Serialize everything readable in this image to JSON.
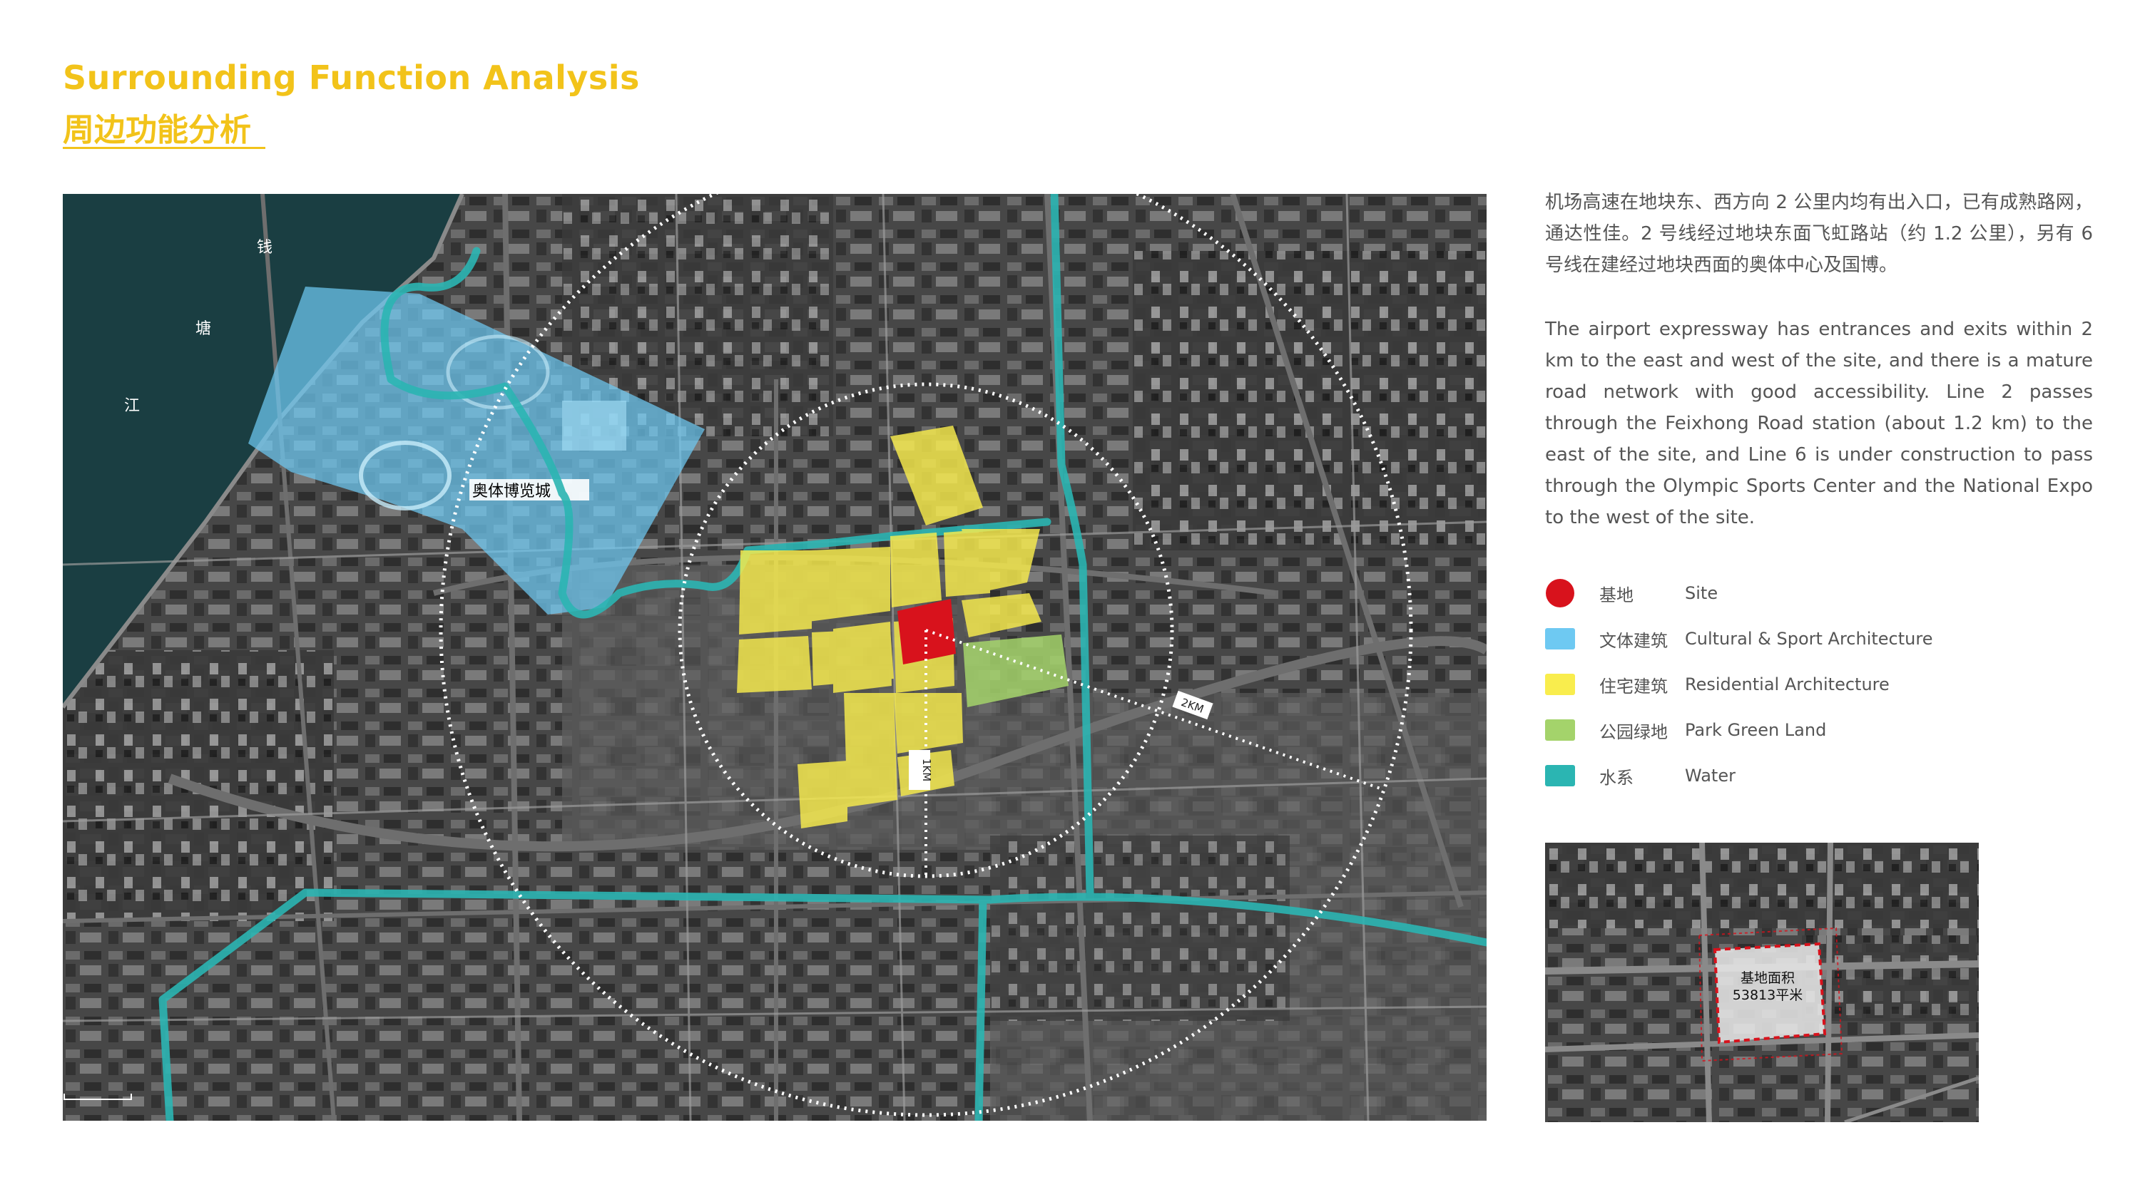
{
  "header": {
    "title_en": "Surrounding Function Analysis",
    "title_cn": "周边功能分析"
  },
  "map": {
    "river_chars": [
      "钱",
      "塘",
      "江"
    ],
    "expo_label": "奥体博览城",
    "radius_1km": "1KM",
    "radius_2km": "2KM"
  },
  "description": {
    "cn": "机场高速在地块东、西方向 2 公里内均有出入口，已有成熟路网，通达性佳。2 号线经过地块东面飞虹路站（约 1.2 公里），另有 6 号线在建经过地块西面的奥体中心及国博。",
    "en": "The airport expressway has entrances and exits within 2 km to the east and west of the site, and there is a mature road network with good accessibility. Line 2 passes through the Feixhong Road station (about 1.2 km) to the east of the site, and Line 6 is under construction to pass through the Olympic Sports Center and the National Expo to the west of the site."
  },
  "legend": [
    {
      "cn": "基地",
      "en": "Site",
      "color": "#d8121c",
      "shape": "circle"
    },
    {
      "cn": "文体建筑",
      "en": "Cultural & Sport Architecture",
      "color": "#6ec9f2",
      "shape": "rect"
    },
    {
      "cn": "住宅建筑",
      "en": "Residential Architecture",
      "color": "#f9ed4d",
      "shape": "rect"
    },
    {
      "cn": "公园绿地",
      "en": "Park Green Land",
      "color": "#a4d36b",
      "shape": "rect"
    },
    {
      "cn": "水系",
      "en": "Water",
      "color": "#2bb5b2",
      "shape": "rect"
    }
  ],
  "inset": {
    "area_label": "基地面积",
    "area_value": "53813平米"
  }
}
